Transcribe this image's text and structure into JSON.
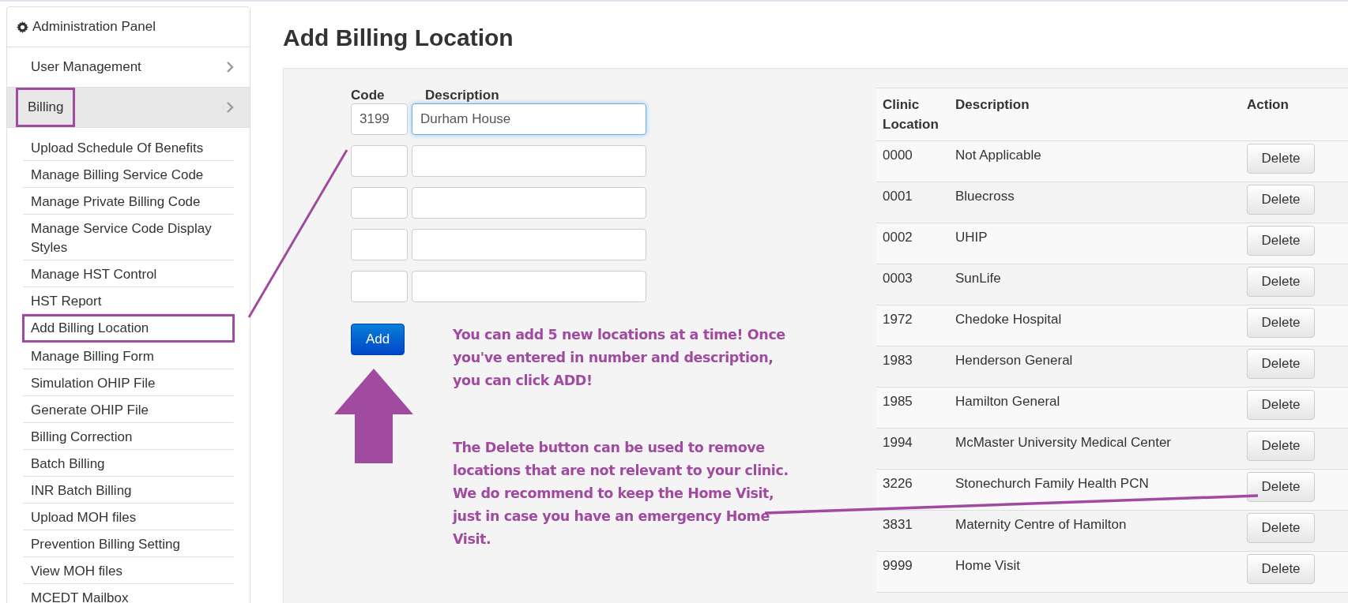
{
  "sidebar": {
    "title": "Administration Panel",
    "sections": [
      {
        "label": "User Management",
        "selected": false,
        "highlighted": false
      },
      {
        "label": "Billing",
        "selected": true,
        "highlighted": true
      }
    ],
    "items": [
      {
        "label": "Upload Schedule Of Benefits",
        "highlighted": false
      },
      {
        "label": "Manage Billing Service Code",
        "highlighted": false
      },
      {
        "label": "Manage Private Billing Code",
        "highlighted": false
      },
      {
        "label": "Manage Service Code Display Styles",
        "highlighted": false
      },
      {
        "label": "Manage HST Control",
        "highlighted": false
      },
      {
        "label": "HST Report",
        "highlighted": false
      },
      {
        "label": "Add Billing Location",
        "highlighted": true
      },
      {
        "label": "Manage Billing Form",
        "highlighted": false
      },
      {
        "label": "Simulation OHIP File",
        "highlighted": false
      },
      {
        "label": "Generate OHIP File",
        "highlighted": false
      },
      {
        "label": "Billing Correction",
        "highlighted": false
      },
      {
        "label": "Batch Billing",
        "highlighted": false
      },
      {
        "label": "INR Batch Billing",
        "highlighted": false
      },
      {
        "label": "Upload MOH files",
        "highlighted": false
      },
      {
        "label": "Prevention Billing Setting",
        "highlighted": false
      },
      {
        "label": "View MOH files",
        "highlighted": false
      },
      {
        "label": "MCEDT Mailbox",
        "highlighted": false
      }
    ]
  },
  "page_title": "Add Billing Location",
  "form": {
    "columns": [
      "Code",
      "Description"
    ],
    "rows": [
      {
        "code": "3199",
        "description": "Durham House",
        "focused": true
      },
      {
        "focused": false
      },
      {
        "focused": false
      },
      {
        "focused": false
      },
      {
        "focused": false
      }
    ],
    "add_button": "Add"
  },
  "notes": [
    "You can add 5 new locations at a time! Once you've entered in number and description, you can click ADD!",
    "The Delete button can be used to remove locations that are not relevant to your clinic.  We do recommend to keep the Home Visit, just in case you have an emergency Home Visit."
  ],
  "table": {
    "columns": [
      "Clinic Location",
      "Description",
      "Action"
    ],
    "rows": [
      {
        "code": "0000",
        "description": "Not Applicable",
        "action": "Delete"
      },
      {
        "code": "0001",
        "description": "Bluecross",
        "action": "Delete"
      },
      {
        "code": "0002",
        "description": "UHIP",
        "action": "Delete"
      },
      {
        "code": "0003",
        "description": "SunLife",
        "action": "Delete"
      },
      {
        "code": "1972",
        "description": "Chedoke Hospital",
        "action": "Delete"
      },
      {
        "code": "1983",
        "description": "Henderson General",
        "action": "Delete"
      },
      {
        "code": "1985",
        "description": "Hamilton General",
        "action": "Delete"
      },
      {
        "code": "1994",
        "description": "McMaster University Medical Center",
        "action": "Delete"
      },
      {
        "code": "3226",
        "description": "Stonechurch Family Health PCN",
        "action": "Delete"
      },
      {
        "code": "3831",
        "description": "Maternity Centre of Hamilton",
        "action": "Delete"
      },
      {
        "code": "9999",
        "description": "Home Visit",
        "action": "Delete"
      }
    ]
  }
}
